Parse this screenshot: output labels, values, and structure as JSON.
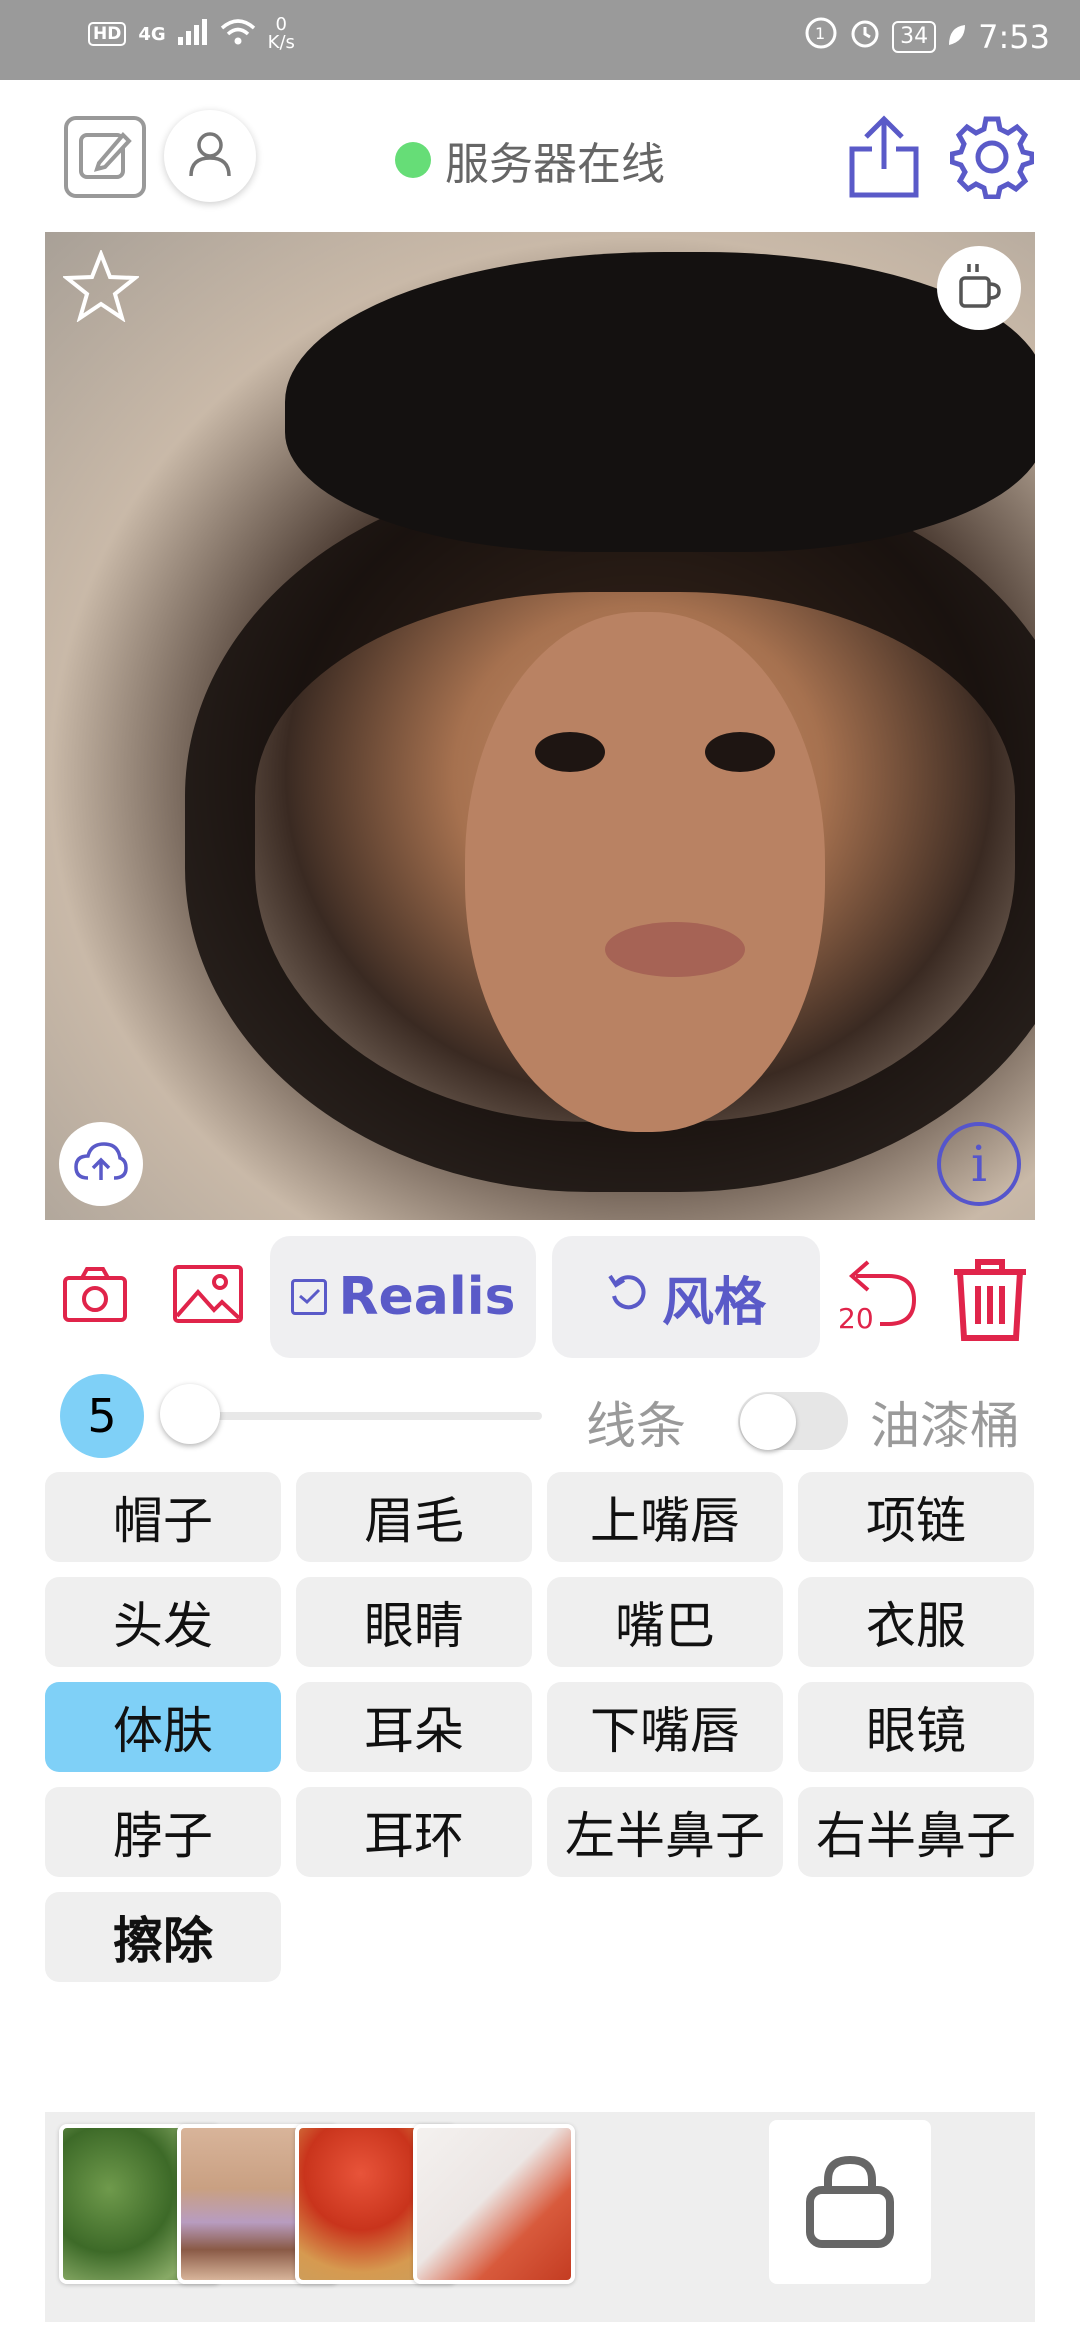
{
  "status_bar": {
    "network_badge": "HD",
    "network_type": "4G",
    "speed_value": "0",
    "speed_unit": "K/s",
    "battery": "34",
    "time": "7:53"
  },
  "header": {
    "server_status": "服务器在线",
    "status_color": "#66dd77"
  },
  "toolbar": {
    "model_label": "Realis",
    "style_label": "风格",
    "undo_count": "20"
  },
  "controls": {
    "brush_size": "5",
    "line_label": "线条",
    "bucket_label": "油漆桶",
    "slider_value": 0,
    "bucket_toggle_on": false
  },
  "parts": [
    {
      "label": "帽子"
    },
    {
      "label": "眉毛"
    },
    {
      "label": "上嘴唇"
    },
    {
      "label": "项链"
    },
    {
      "label": "头发"
    },
    {
      "label": "眼睛"
    },
    {
      "label": "嘴巴"
    },
    {
      "label": "衣服"
    },
    {
      "label": "体肤",
      "selected": true
    },
    {
      "label": "耳朵"
    },
    {
      "label": "下嘴唇"
    },
    {
      "label": "眼镜"
    },
    {
      "label": "脖子"
    },
    {
      "label": "耳环"
    },
    {
      "label": "左半鼻子"
    },
    {
      "label": "右半鼻子"
    },
    {
      "label": "擦除"
    }
  ],
  "colors": {
    "accent_purple": "#5a5ac8",
    "accent_red": "#e0244a",
    "selected_blue": "#7fd0f7"
  },
  "icons": [
    "edit-icon",
    "user-icon",
    "share-icon",
    "gear-icon",
    "star-icon",
    "cup-icon",
    "upload-icon",
    "info-icon",
    "camera-icon",
    "image-icon",
    "undo-icon",
    "trash-icon",
    "bag-icon"
  ]
}
